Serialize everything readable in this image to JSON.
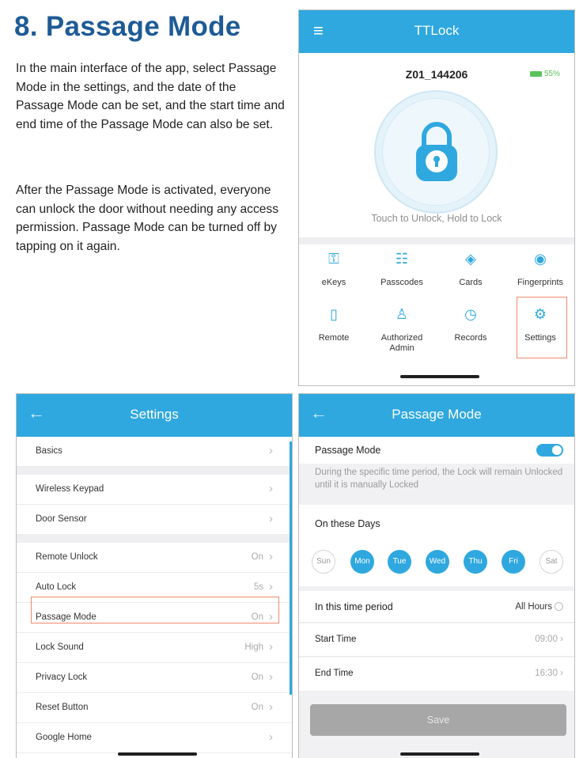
{
  "heading": "8. Passage Mode",
  "paragraphs": [
    "In the main interface of the app, select Passage Mode in the settings, and the date of the Passage Mode can be set, and the start time and end time of the Passage Mode can also be set.",
    "After the Passage Mode is activated, everyone can unlock the door without needing any access permission. Passage Mode can be turned off by tapping on it again."
  ],
  "main_screen": {
    "app_title": "TTLock",
    "lock_name": "Z01_144206",
    "battery": "55%",
    "hint": "Touch to Unlock, Hold to Lock",
    "menu": [
      {
        "label": "eKeys",
        "icon": "ekey-icon"
      },
      {
        "label": "Passcodes",
        "icon": "passcodes-icon"
      },
      {
        "label": "Cards",
        "icon": "cards-icon"
      },
      {
        "label": "Fingerprints",
        "icon": "fingerprint-icon"
      },
      {
        "label": "Remote",
        "icon": "remote-icon"
      },
      {
        "label": "Authorized Admin",
        "icon": "admin-icon"
      },
      {
        "label": "Records",
        "icon": "records-icon"
      },
      {
        "label": "Settings",
        "icon": "settings-icon"
      }
    ]
  },
  "settings_screen": {
    "title": "Settings",
    "rows": [
      {
        "label": "Basics",
        "value": ""
      },
      {
        "label": "Wireless Keypad",
        "value": ""
      },
      {
        "label": "Door Sensor",
        "value": ""
      },
      {
        "label": "Remote Unlock",
        "value": "On"
      },
      {
        "label": "Auto Lock",
        "value": "5s"
      },
      {
        "label": "Passage Mode",
        "value": "On"
      },
      {
        "label": "Lock Sound",
        "value": "High"
      },
      {
        "label": "Privacy Lock",
        "value": "On"
      },
      {
        "label": "Reset Button",
        "value": "On"
      },
      {
        "label": "Google Home",
        "value": ""
      }
    ]
  },
  "passage_screen": {
    "title": "Passage Mode",
    "toggle_label": "Passage Mode",
    "toggle_on": true,
    "description": "During the specific time period, the Lock will remain Unlocked until it is manually Locked",
    "days_label": "On these Days",
    "days": [
      {
        "label": "Sun",
        "selected": false
      },
      {
        "label": "Mon",
        "selected": true
      },
      {
        "label": "Tue",
        "selected": true
      },
      {
        "label": "Wed",
        "selected": true
      },
      {
        "label": "Thu",
        "selected": true
      },
      {
        "label": "Fri",
        "selected": true
      },
      {
        "label": "Sat",
        "selected": false
      }
    ],
    "period_label": "In this time period",
    "all_hours_label": "All Hours",
    "start_label": "Start Time",
    "start_value": "09:00",
    "end_label": "End Time",
    "end_value": "16:30",
    "save_label": "Save"
  },
  "colors": {
    "heading": "#1e5b96",
    "app_bar": "#2fa8df",
    "highlight_box": "#ef8a6f",
    "save_disabled": "#a7a7a7"
  }
}
